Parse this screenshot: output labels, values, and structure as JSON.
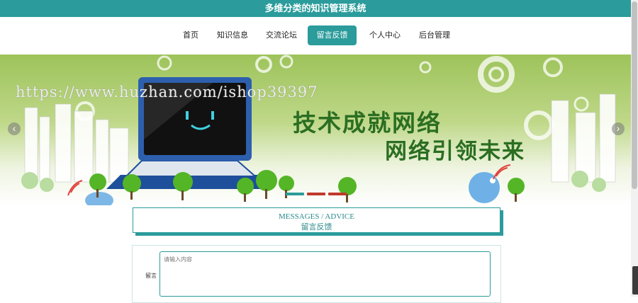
{
  "header": {
    "title": "多维分类的知识管理系统"
  },
  "nav": {
    "items": [
      {
        "label": "首页",
        "active": false
      },
      {
        "label": "知识信息",
        "active": false
      },
      {
        "label": "交流论坛",
        "active": false
      },
      {
        "label": "留言反馈",
        "active": true
      },
      {
        "label": "个人中心",
        "active": false
      },
      {
        "label": "后台管理",
        "active": false
      }
    ]
  },
  "banner": {
    "watermark": "https://www.huzhan.com/ishop39397",
    "slogan_line1": "技术成就网络",
    "slogan_line2": "网络引领未来",
    "prev_arrow": "‹",
    "next_arrow": "›",
    "active_slide": 1,
    "slide_count": 3
  },
  "messages": {
    "title_en": "MESSAGES / ADVICE",
    "title_cn": "留言反馈"
  },
  "form": {
    "label": "留言",
    "placeholder": "请输入内容",
    "value": ""
  },
  "colors": {
    "accent": "#2b9b9b",
    "slogan": "#2b6e22"
  }
}
